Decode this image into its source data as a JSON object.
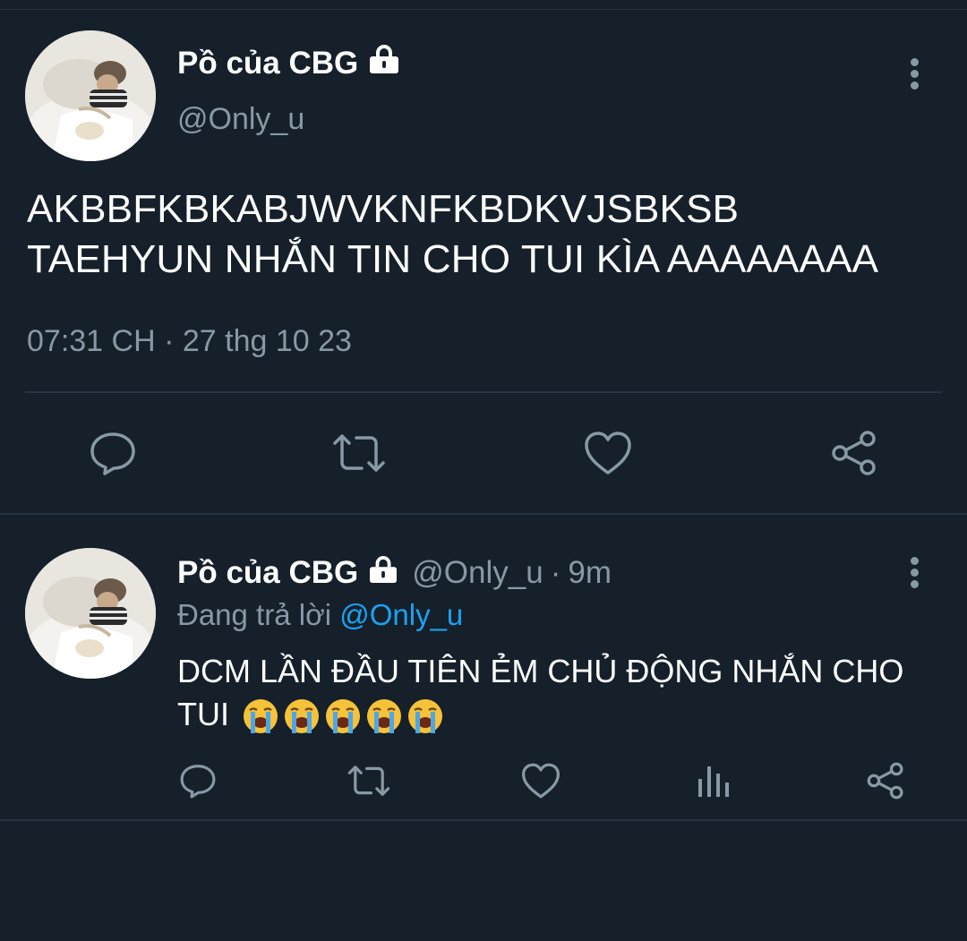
{
  "colors": {
    "background": "#15202b",
    "divider": "#253341",
    "text_primary": "#ffffff",
    "text_secondary": "#8899a6",
    "link": "#1da1f2"
  },
  "main_tweet": {
    "display_name": "Pồ của CBG",
    "protected_icon": "lock-icon",
    "handle": "@Only_u",
    "text_line_1": "AKBBFKBKABJWVKNFKBDKVJSBKSB",
    "text_line_2": "TAEHYUN NHẮN TIN CHO TUI KÌA AAAAAAAA",
    "time": "07:31 CH",
    "separator": "·",
    "date": "27 thg 10 23",
    "actions": [
      "reply-icon",
      "retweet-icon",
      "like-icon",
      "share-icon"
    ]
  },
  "reply_tweet": {
    "display_name": "Pồ của CBG",
    "protected_icon": "lock-icon",
    "handle": "@Only_u",
    "separator": "·",
    "time": "9m",
    "replying_label": "Đang trả lời",
    "replying_to": "@Only_u",
    "text": "DCM LẦN ĐẦU TIÊN ẺM CHỦ ĐỘNG NHẮN CHO TUI",
    "emoji_count": 5,
    "emoji_name": "loudly-crying-face",
    "actions": [
      "reply-icon",
      "retweet-icon",
      "like-icon",
      "analytics-icon",
      "share-icon"
    ]
  }
}
